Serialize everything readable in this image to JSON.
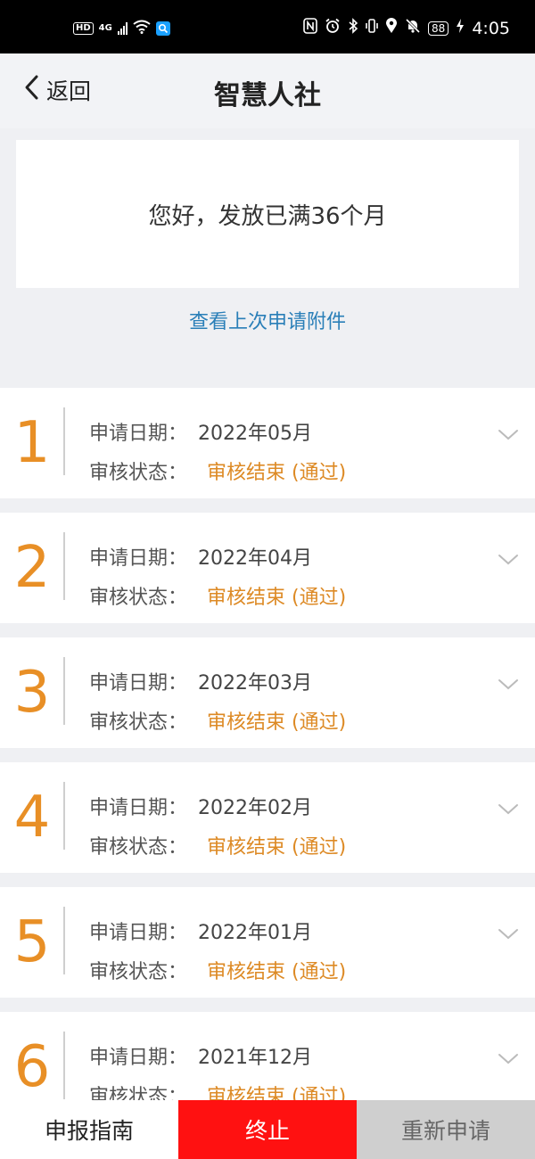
{
  "status_bar": {
    "left": {
      "hd": "HD",
      "network": "4G",
      "search_badge_color": "#1aa0ff"
    },
    "right": {
      "battery": "88",
      "time": "4:05"
    }
  },
  "navbar": {
    "back_label": "返回",
    "title": "智慧人社"
  },
  "message": {
    "text": "您好，发放已满36个月",
    "link": "查看上次申请附件"
  },
  "records": [
    {
      "index": "1",
      "date_label": "申请日期：",
      "date": "2022年05月",
      "status_label": "审核状态：",
      "status": "审核结束 (通过)"
    },
    {
      "index": "2",
      "date_label": "申请日期：",
      "date": "2022年04月",
      "status_label": "审核状态：",
      "status": "审核结束 (通过)"
    },
    {
      "index": "3",
      "date_label": "申请日期：",
      "date": "2022年03月",
      "status_label": "审核状态：",
      "status": "审核结束 (通过)"
    },
    {
      "index": "4",
      "date_label": "申请日期：",
      "date": "2022年02月",
      "status_label": "审核状态：",
      "status": "审核结束 (通过)"
    },
    {
      "index": "5",
      "date_label": "申请日期：",
      "date": "2022年01月",
      "status_label": "审核状态：",
      "status": "审核结束 (通过)"
    },
    {
      "index": "6",
      "date_label": "申请日期：",
      "date": "2021年12月",
      "status_label": "审核状态：",
      "status": "审核结束 (通过)"
    }
  ],
  "bottom_bar": {
    "guide": "申报指南",
    "stop": "终止",
    "reapply": "重新申请"
  },
  "colors": {
    "accent_orange": "#e88f26",
    "stop_red": "#ff1111",
    "link_blue": "#2a7fb8",
    "disabled_gray": "#cfcfcf"
  }
}
